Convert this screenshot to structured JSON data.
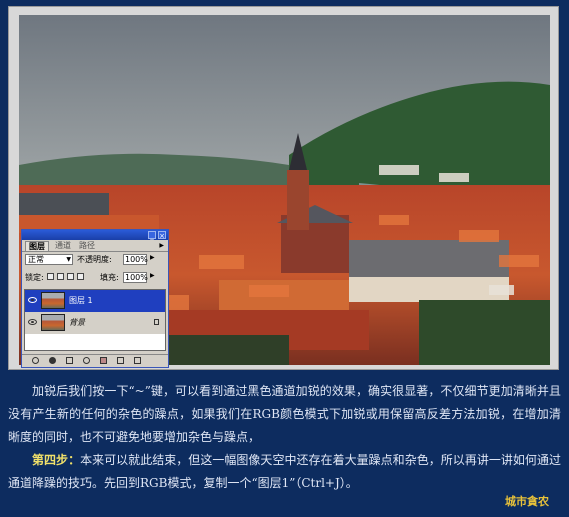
{
  "panel": {
    "tabs": [
      "图层",
      "通道",
      "路径"
    ],
    "blend_mode": "正常",
    "opacity_label": "不透明度:",
    "opacity_value": "100%",
    "lock_label": "锁定:",
    "fill_label": "填充:",
    "fill_value": "100%",
    "layers": [
      {
        "name": "图层 1",
        "selected": true
      },
      {
        "name": "背景",
        "selected": false
      }
    ],
    "title_buttons": [
      "_",
      "×"
    ]
  },
  "text": {
    "para1": "加锐后我们按一下“~”键，可以看到通过黑色通道加锐的效果，确实很显著，不仅细节更加清晰并且没有产生新的任何的杂色的躁点，如果我们在RGB颜色模式下加锐或用保留高反差方法加锐，在增加清晰度的同时，也不可避免地要增加杂色与躁点，",
    "step_label": "第四步：",
    "para2": "本来可以就此结束，但这一幅图像天空中还存在着大量躁点和杂色，所以再讲一讲如何通过通道降躁的技巧。先回到RGB模式，复制一个“图层1”（Ctrl+J）。"
  },
  "signature": "城市貪农",
  "colors": {
    "background": "#0d2c5f",
    "step": "#f0e06a",
    "signature": "#e8c23a",
    "selection": "#1f3fbf"
  }
}
